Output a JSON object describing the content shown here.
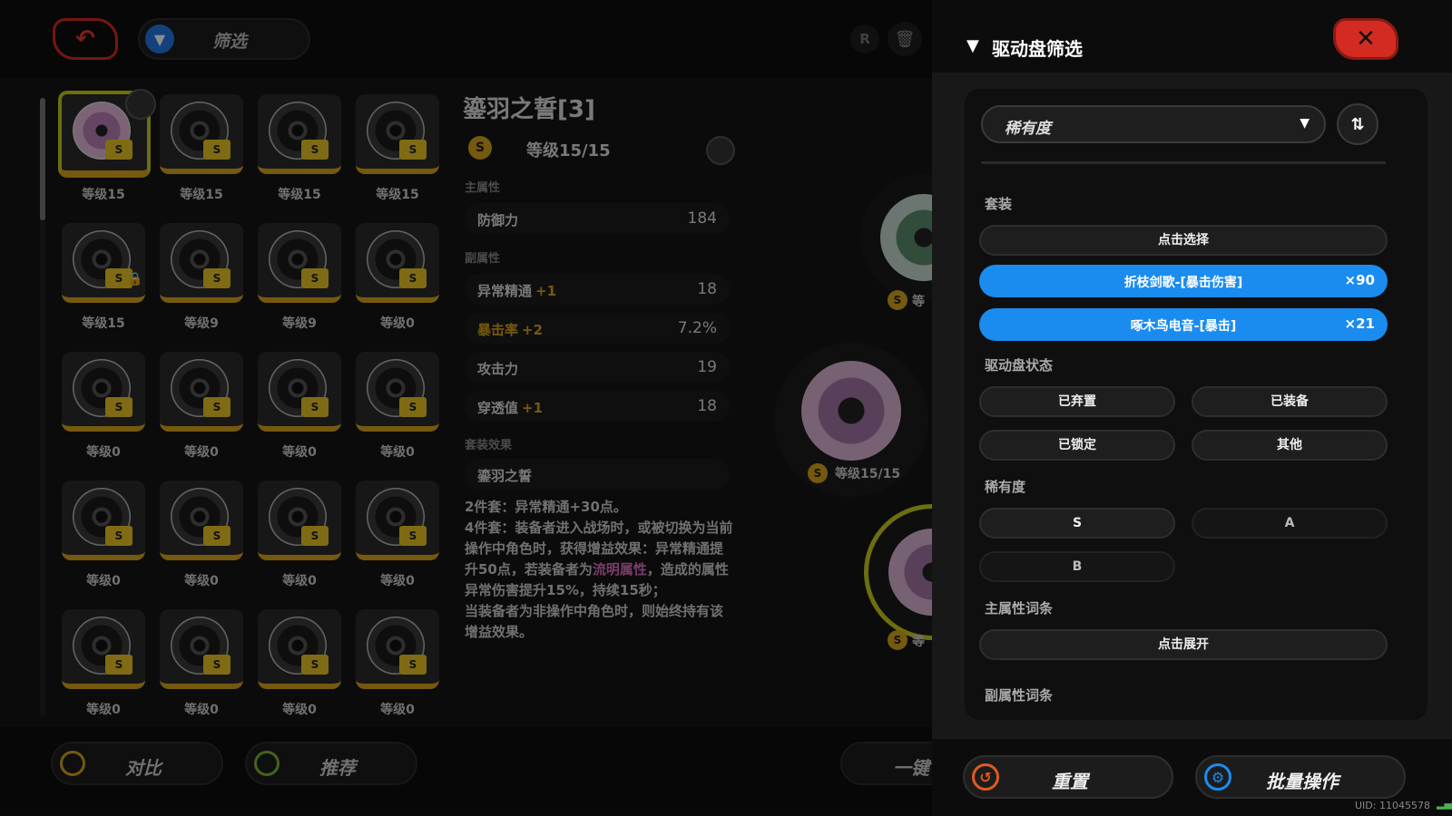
{
  "topbar": {
    "filter_label": "筛选",
    "r_label": "R"
  },
  "grid": [
    {
      "level": "等级15",
      "variant": "pink",
      "selected": true,
      "locked": false,
      "avatar": true
    },
    {
      "level": "等级15"
    },
    {
      "level": "等级15"
    },
    {
      "level": "等级15"
    },
    {
      "level": "等级15",
      "locked": true
    },
    {
      "level": "等级9"
    },
    {
      "level": "等级9"
    },
    {
      "level": "等级0"
    },
    {
      "level": "等级0"
    },
    {
      "level": "等级0"
    },
    {
      "level": "等级0"
    },
    {
      "level": "等级0"
    },
    {
      "level": "等级0"
    },
    {
      "level": "等级0"
    },
    {
      "level": "等级0"
    },
    {
      "level": "等级0"
    },
    {
      "level": "等级0"
    },
    {
      "level": "等级0"
    },
    {
      "level": "等级0"
    },
    {
      "level": "等级0"
    }
  ],
  "disc_badge": "S",
  "detail": {
    "title": "鎏羽之誓[3]",
    "rank": "S",
    "level": "等级15/15",
    "main_stat_header": "主属性",
    "main_stat": {
      "name": "防御力",
      "value": "184"
    },
    "sub_stat_header": "副属性",
    "sub_stats": [
      {
        "name": "异常精通",
        "up": "+1",
        "value": "18",
        "highlight": false
      },
      {
        "name": "暴击率",
        "up": "+2",
        "value": "7.2%",
        "highlight": true
      },
      {
        "name": "攻击力",
        "up": "",
        "value": "19",
        "highlight": false
      },
      {
        "name": "穿透值",
        "up": "+1",
        "value": "18",
        "highlight": false
      }
    ],
    "set_header": "套装效果",
    "set_name": "鎏羽之誓",
    "set_desc_1": "2件套：异常精通+30点。",
    "set_desc_2a": "4件套：装备者进入战场时，或被切换为当前操作中角色时，获得增益效果：异常精通提升50点，若装备者为",
    "set_desc_2b": "流明属性",
    "set_desc_2c": "，造成的属性异常伤害提升15%，持续15秒；",
    "set_desc_3": "当装备者为非操作中角色时，则始终持有该增益效果。"
  },
  "orbs": {
    "level_mid": "等级15/15",
    "level_cut1": "等",
    "level_cut2": "等"
  },
  "bottom": {
    "compare": "对比",
    "recommend": "推荐",
    "one_key": "一键"
  },
  "panel": {
    "title": "驱动盘筛选",
    "sort_select": "稀有度",
    "set_header": "套装",
    "set_select_btn": "点击选择",
    "selected_sets": [
      {
        "name": "折枝剑歌-[暴击伤害]",
        "count": "×90"
      },
      {
        "name": "啄木鸟电音-[暴击]",
        "count": "×21"
      }
    ],
    "status_header": "驱动盘状态",
    "status": [
      "已弃置",
      "已装备",
      "已锁定",
      "其他"
    ],
    "rarity_header": "稀有度",
    "rarity": [
      "S",
      "A",
      "B"
    ],
    "main_stat_header": "主属性词条",
    "expand_btn": "点击展开",
    "sub_stat_header": "副属性词条",
    "reset": "重置",
    "batch": "批量操作",
    "uid": "UID: 11045578"
  },
  "colors": {
    "accent_blue": "#1a8cf0",
    "close_red": "#d32b22",
    "gold": "#d6a21c"
  }
}
